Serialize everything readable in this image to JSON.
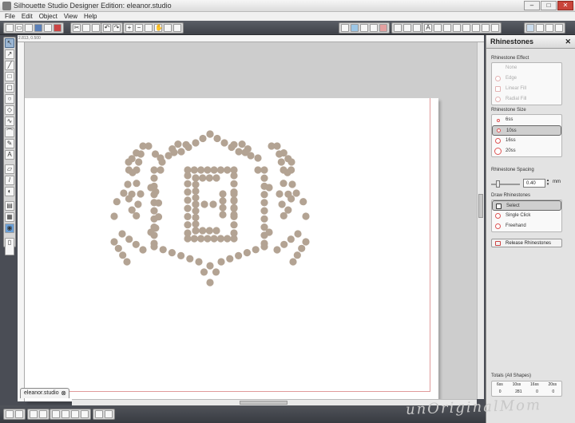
{
  "app": {
    "title": "Silhouette Studio Designer Edition: eleanor.studio"
  },
  "menu": [
    "File",
    "Edit",
    "Object",
    "View",
    "Help"
  ],
  "canvas": {
    "coordinates": "2.813, 0.500",
    "doc_tab": "eleanor.studio",
    "design_letter": "E",
    "dot_color": "#b3a393"
  },
  "panel": {
    "title": "Rhinestones",
    "effect": {
      "label": "Rhinestone Effect",
      "options": [
        "None",
        "Edge",
        "Linear Fill",
        "Radial Fill"
      ]
    },
    "size": {
      "label": "Rhinestone Size",
      "options": [
        "6ss",
        "10ss",
        "16ss",
        "20ss"
      ],
      "selected": "10ss"
    },
    "spacing": {
      "label": "Rhinestone Spacing",
      "value": "0.40",
      "unit": "mm"
    },
    "draw": {
      "label": "Draw Rhinestones",
      "options": [
        "Select",
        "Single Click",
        "Freehand"
      ],
      "selected": "Select"
    },
    "release": "Release Rhinestones",
    "totals": {
      "label": "Totals (All Shapes)",
      "headers": [
        "6ss",
        "10ss",
        "16ss",
        "20ss"
      ],
      "values": [
        "0",
        "281",
        "0",
        "0"
      ]
    }
  },
  "watermark": "unOriginalMom"
}
